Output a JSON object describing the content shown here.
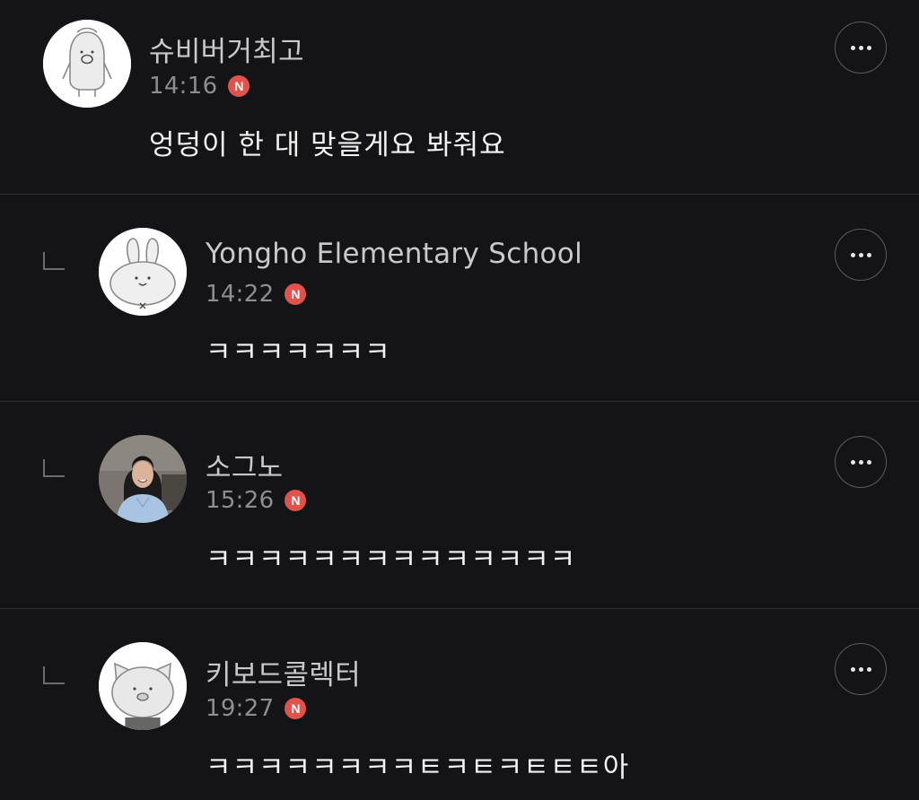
{
  "comments": [
    {
      "author": "슈비버거최고",
      "time": "14:16",
      "badge": "N",
      "text": "엉덩이 한 대 맞을게요 봐줘요",
      "avatar": "penguin-avatar",
      "is_reply": false
    },
    {
      "author": "Yongho Elementary School",
      "time": "14:22",
      "badge": "N",
      "text": "ㅋㅋㅋㅋㅋㅋㅋ",
      "avatar": "rabbit-avatar",
      "is_reply": true
    },
    {
      "author": "소그노",
      "time": "15:26",
      "badge": "N",
      "text": "ㅋㅋㅋㅋㅋㅋㅋㅋㅋㅋㅋㅋㅋㅋ",
      "avatar": "profile-photo",
      "is_reply": true
    },
    {
      "author": "키보드콜렉터",
      "time": "19:27",
      "badge": "N",
      "text": "ㅋㅋㅋㅋㅋㅋㅋㅋㅌㅋㅌㅋㅌㅌㅌ아",
      "avatar": "cat-avatar",
      "is_reply": true
    }
  ],
  "icons": {
    "more": "more-options-icon",
    "reply": "reply-indent-icon"
  },
  "colors": {
    "background": "#141416",
    "badge": "#e0524b",
    "divider": "#2f2f33"
  }
}
